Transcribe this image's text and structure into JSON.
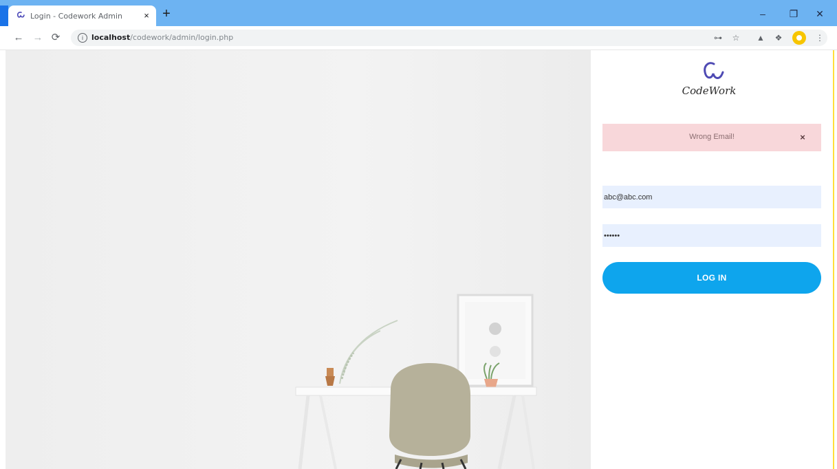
{
  "browser": {
    "tab_title": "Login - Codework Admin",
    "tab_close": "×",
    "new_tab": "+",
    "url_host": "localhost",
    "url_path": "/codework/admin/login.php",
    "window_controls": {
      "minimize": "–",
      "restore": "❐",
      "close": "✕"
    }
  },
  "login": {
    "logo_text": "CodeWork",
    "alert": {
      "message": "Wrong Email!",
      "close": "×"
    },
    "email": {
      "value": "abc@abc.com",
      "placeholder": ""
    },
    "password": {
      "value": "••••••",
      "placeholder": ""
    },
    "login_button": "LOG IN"
  },
  "colors": {
    "tabbar": "#6db3f2",
    "alert_bg": "#f8d7da",
    "input_bg": "#e8f0fe",
    "button": "#0ea5ed",
    "panel_border": "#ffde3b"
  }
}
